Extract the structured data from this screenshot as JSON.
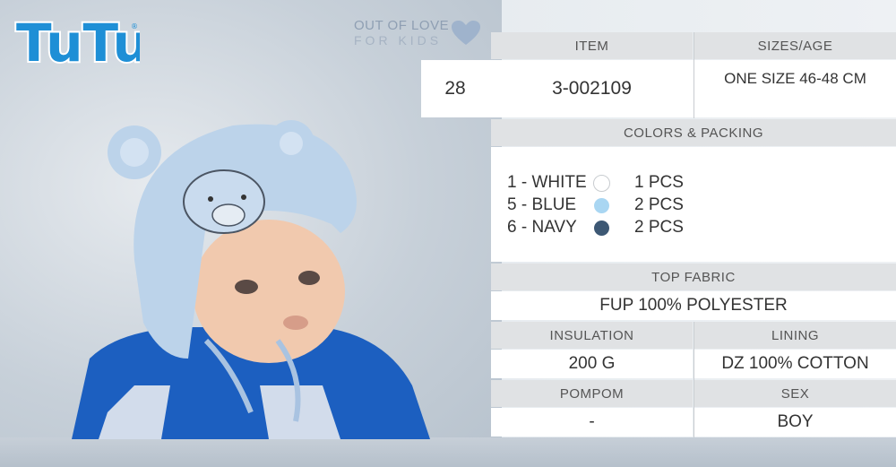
{
  "brand": {
    "logo_text": "TuTu",
    "tagline_line1": "OUT OF LOVE",
    "tagline_line2": "FOR KIDS"
  },
  "table": {
    "item_header": "ITEM",
    "sizes_header": "SIZES/AGE",
    "number": "28",
    "item_code": "3-002109",
    "size_value": "ONE SIZE 46-48 CM",
    "colors_header": "COLORS & PACKING",
    "colors": [
      {
        "label": "1 - WHITE",
        "swatch": "#ffffff",
        "packing": "1 PCS"
      },
      {
        "label": "5 - BLUE",
        "swatch": "#a9d6f2",
        "packing": "2 PCS"
      },
      {
        "label": "6 - NAVY",
        "swatch": "#3d5874",
        "packing": "2 PCS"
      }
    ],
    "top_fabric_header": "TOP FABRIC",
    "top_fabric_value": "FUP 100% POLYESTER",
    "insulation_header": "INSULATION",
    "insulation_value": "200 G",
    "lining_header": "LINING",
    "lining_value": "DZ 100% COTTON",
    "pompom_header": "POMPOM",
    "pompom_value": "-",
    "sex_header": "SEX",
    "sex_value": "BOY"
  },
  "colors_theme": {
    "logo_blue": "#1e8fd6",
    "header_gray": "#e0e2e4",
    "heart": "#9fb3cc"
  }
}
